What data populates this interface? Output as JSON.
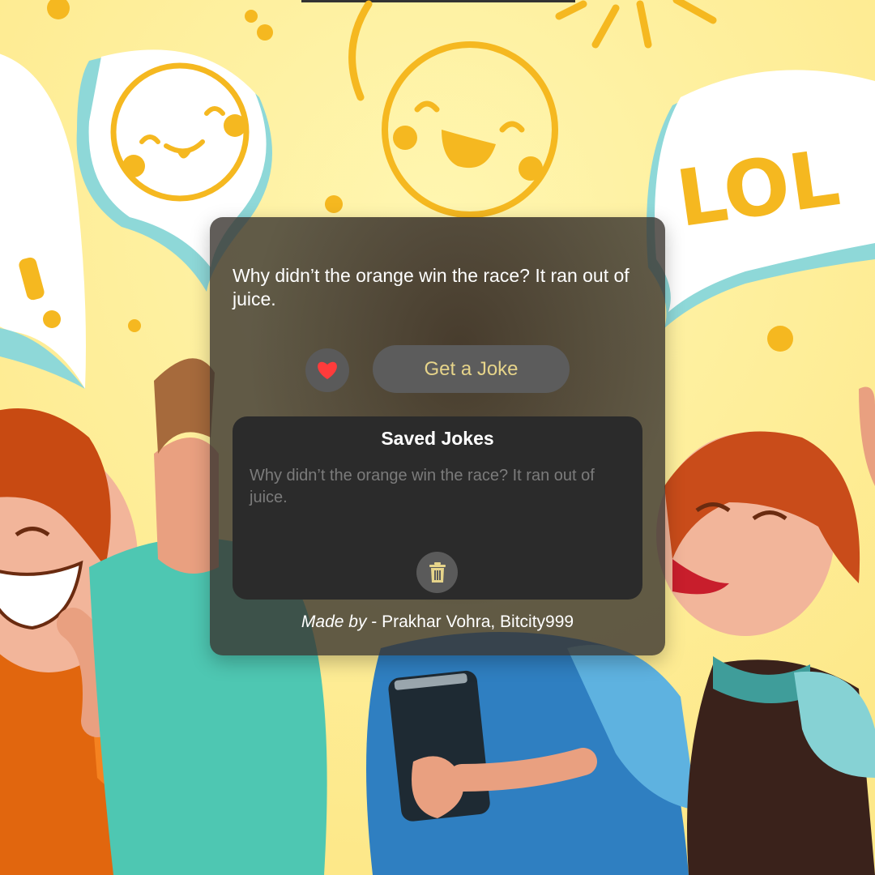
{
  "joke": {
    "text": "Why didn’t the orange win the race? It ran out of juice."
  },
  "actions": {
    "favorite_icon": "heart-icon",
    "get_joke_label": "Get a Joke"
  },
  "saved": {
    "title": "Saved Jokes",
    "items": [
      "Why didn’t the orange win the race? It ran out of juice."
    ],
    "delete_icon": "trash-icon"
  },
  "footer": {
    "made_by_label": "Made by",
    "separator": " - ",
    "authors": "Prakhar Vohra, Bitcity999"
  },
  "background": {
    "bubble_text": "LOL",
    "exclamation": "!"
  },
  "colors": {
    "background": "#fdf3a3",
    "accent_yellow": "#fbbf24",
    "heart": "#ff3b3b",
    "button_text": "#e6d48a",
    "trash": "#e6d48a"
  }
}
